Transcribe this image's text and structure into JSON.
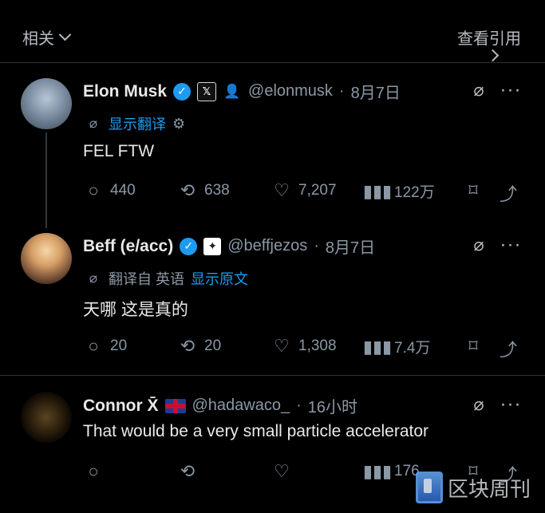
{
  "topbar": {
    "left_label": "相关",
    "right_label": "查看引用"
  },
  "posts": [
    {
      "name": "Elon Musk",
      "handle": "@elonmusk",
      "date_separator": "·",
      "date": "8月7日",
      "translate_link": "显示翻译",
      "text": "FEL FTW",
      "replies": "440",
      "reposts": "638",
      "likes": "7,207",
      "views": "122万"
    },
    {
      "name": "Beff (e/acc)",
      "handle": "@beffjezos",
      "date_separator": "·",
      "date": "8月7日",
      "translated_from": "翻译自 英语",
      "translate_link": "显示原文",
      "text": "天哪 这是真的",
      "replies": "20",
      "reposts": "20",
      "likes": "1,308",
      "views": "7.4万"
    },
    {
      "name": "Connor X̄",
      "handle": "@hadawaco_",
      "date_separator": "·",
      "date": "16小时",
      "text": "That would be a very small particle accelerator",
      "views": "176"
    }
  ],
  "icons": {
    "verified": "✓",
    "x_badge": "𝕏",
    "star_badge": "✦",
    "user_badge": "👤",
    "grok": "⌀",
    "more": "···",
    "reply": "○",
    "repost": "⟲",
    "like": "♡",
    "views": "▮▮▮",
    "bookmark": "⌑",
    "share": "⤴",
    "settings": "⚙"
  },
  "colors": {
    "background": "#000000",
    "text": "#e7e9ea",
    "muted": "#8b98a5",
    "accent": "#1d9bf0",
    "divider": "#2f3336"
  },
  "watermark": {
    "text": "区块周刊"
  }
}
